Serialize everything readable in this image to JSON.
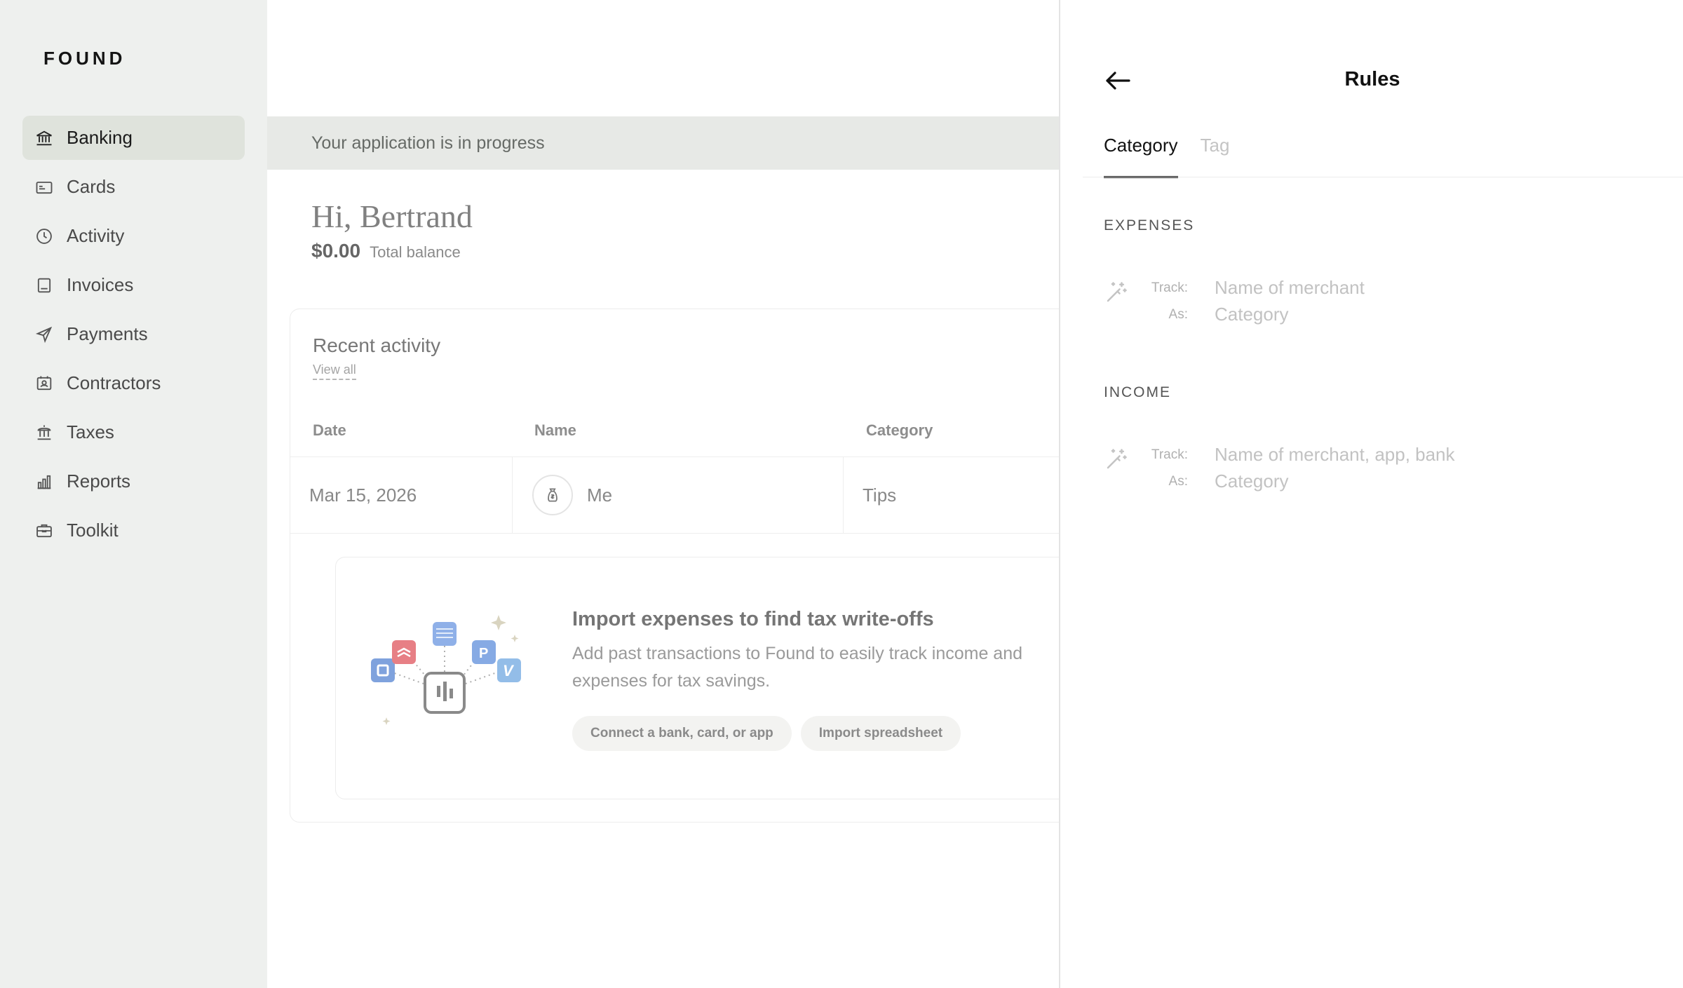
{
  "sidebar": {
    "logo": "FOUND",
    "items": [
      {
        "label": "Banking",
        "icon": "bank-icon",
        "active": true
      },
      {
        "label": "Cards",
        "icon": "card-icon"
      },
      {
        "label": "Activity",
        "icon": "clock-icon"
      },
      {
        "label": "Invoices",
        "icon": "invoice-icon"
      },
      {
        "label": "Payments",
        "icon": "send-icon"
      },
      {
        "label": "Contractors",
        "icon": "contractor-icon"
      },
      {
        "label": "Taxes",
        "icon": "government-icon"
      },
      {
        "label": "Reports",
        "icon": "bar-chart-icon"
      },
      {
        "label": "Toolkit",
        "icon": "briefcase-icon"
      }
    ]
  },
  "main": {
    "banner": "Your application is in progress",
    "greeting": "Hi, Bertrand",
    "balance": {
      "amount": "$0.00",
      "label": "Total balance"
    },
    "recent_activity": {
      "title": "Recent activity",
      "view_all": "View all",
      "columns": [
        "Date",
        "Name",
        "Category"
      ],
      "rows": [
        {
          "date": "Mar 15, 2026",
          "name": "Me",
          "category": "Tips"
        }
      ]
    },
    "import_card": {
      "title": "Import expenses to find tax write-offs",
      "description": "Add past transactions to Found to easily track income and expenses for tax savings.",
      "buttons": [
        "Connect a bank, card, or app",
        "Import spreadsheet"
      ]
    }
  },
  "drawer": {
    "title": "Rules",
    "tabs": [
      {
        "label": "Category",
        "active": true
      },
      {
        "label": "Tag",
        "active": false
      }
    ],
    "sections": [
      {
        "label": "EXPENSES",
        "track_key": "Track:",
        "track_placeholder": "Name of merchant",
        "as_key": "As:",
        "as_placeholder": "Category"
      },
      {
        "label": "INCOME",
        "track_key": "Track:",
        "track_placeholder": "Name of merchant, app, bank",
        "as_key": "As:",
        "as_placeholder": "Category"
      }
    ]
  },
  "colors": {
    "sidebar_bg": "#eef0ee",
    "active_nav_bg": "#dfe3dc",
    "banner_bg": "#e7e9e6"
  }
}
